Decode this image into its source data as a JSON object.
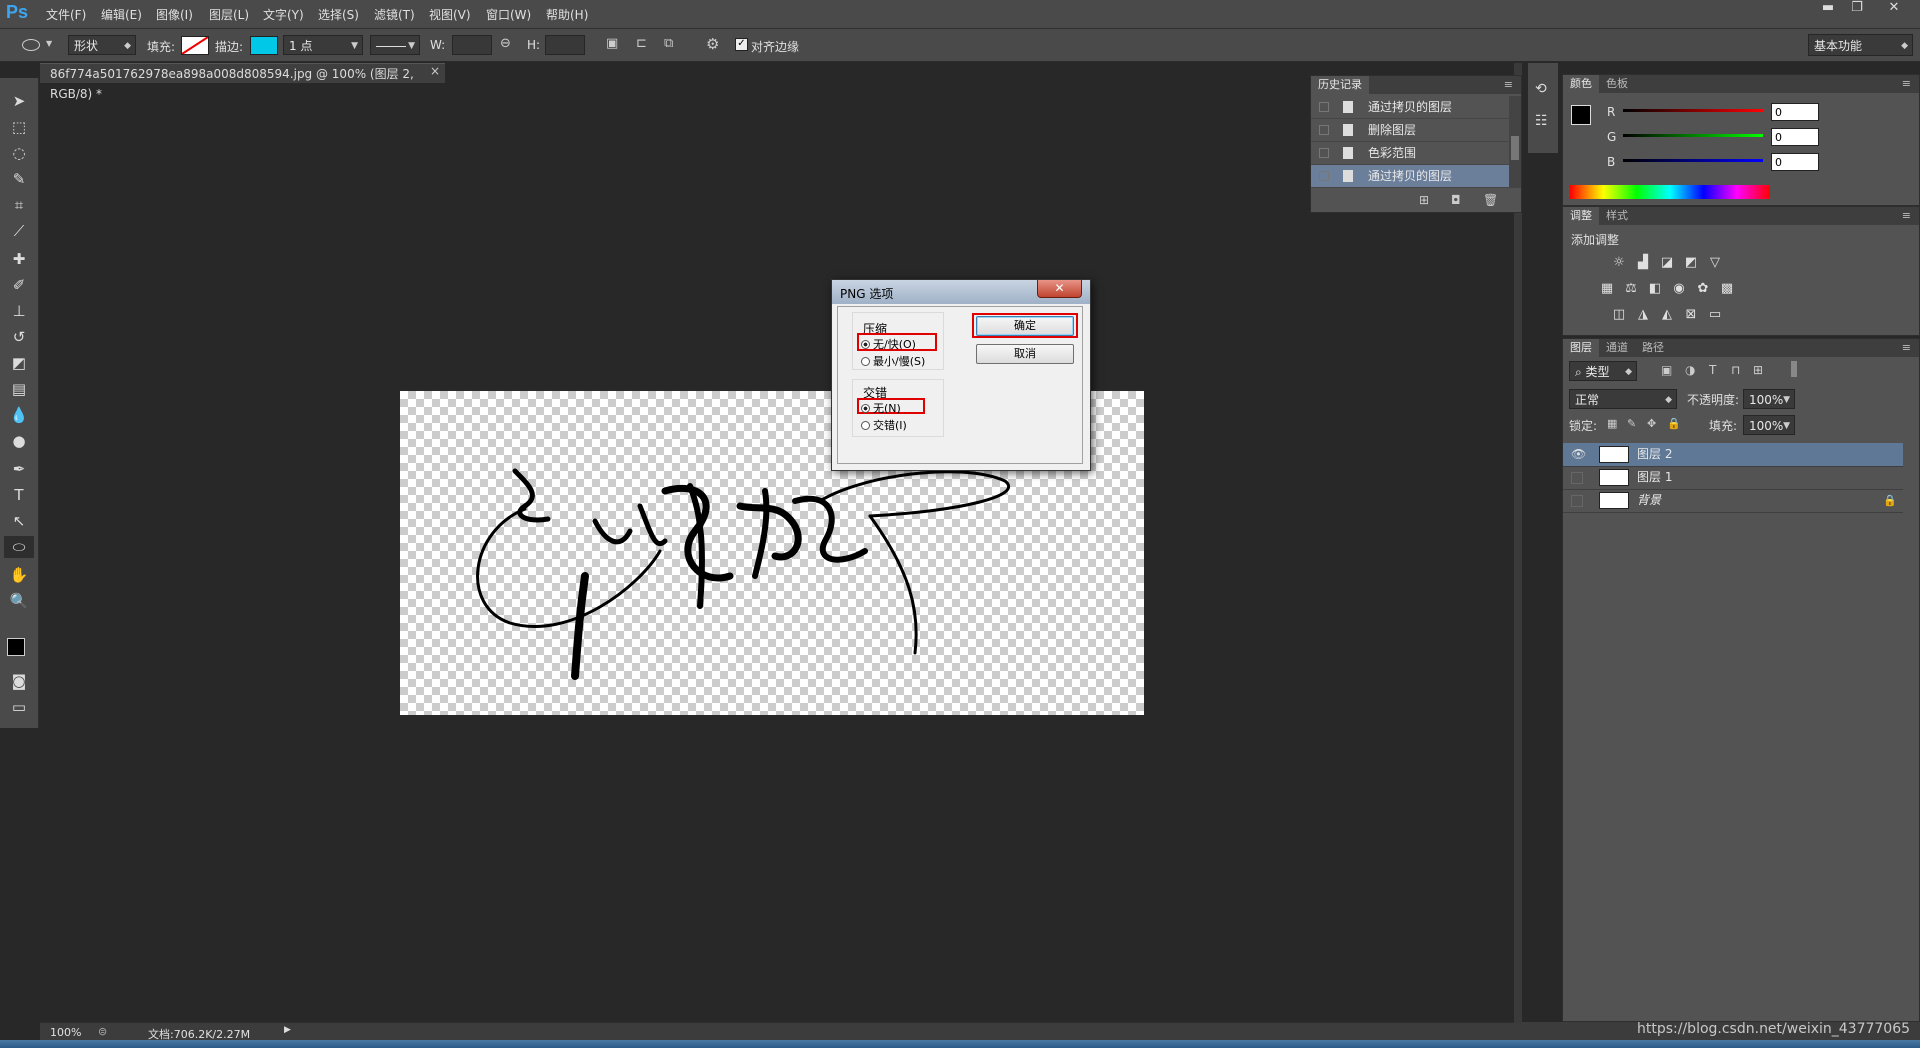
{
  "app": {
    "logo": "Ps"
  },
  "menu": [
    "文件(F)",
    "编辑(E)",
    "图像(I)",
    "图层(L)",
    "文字(Y)",
    "选择(S)",
    "滤镜(T)",
    "视图(V)",
    "窗口(W)",
    "帮助(H)"
  ],
  "window_controls": {
    "minimize": "▬",
    "restore": "❐",
    "close": "✕"
  },
  "options_bar": {
    "mode": "形状",
    "fill_label": "填充:",
    "stroke_label": "描边:",
    "stroke_size": "1 点",
    "w_label": "W:",
    "h_label": "H:",
    "align_edges": "对齐边缘",
    "workspace": "基本功能",
    "stroke_color": "#00c8e6"
  },
  "doc_tab": {
    "title": "86f774a501762978ea898a008d808594.jpg @ 100% (图层 2, RGB/8) *",
    "close": "×"
  },
  "status": {
    "zoom": "100%",
    "doc": "文档:706.2K/2.27M"
  },
  "history": {
    "title": "历史记录",
    "items": [
      "通过拷贝的图层",
      "删除图层",
      "色彩范围",
      "通过拷贝的图层"
    ],
    "selected_index": 3
  },
  "color_panel": {
    "tabs": [
      "颜色",
      "色板"
    ],
    "channels": [
      {
        "name": "R",
        "value": "0"
      },
      {
        "name": "G",
        "value": "0"
      },
      {
        "name": "B",
        "value": "0"
      }
    ]
  },
  "adjust_panel": {
    "tabs": [
      "调整",
      "样式"
    ],
    "heading": "添加调整"
  },
  "layers_panel": {
    "tabs": [
      "图层",
      "通道",
      "路径"
    ],
    "filter": "类型",
    "blend": "正常",
    "opacity_label": "不透明度:",
    "opacity": "100%",
    "lock_label": "锁定:",
    "fill_label": "填充:",
    "fill": "100%",
    "layers": [
      {
        "name": "图层 2",
        "visible": true,
        "selected": true
      },
      {
        "name": "图层 1",
        "visible": false,
        "selected": false
      },
      {
        "name": "背景",
        "visible": false,
        "selected": false
      }
    ]
  },
  "dialog": {
    "title": "PNG 选项",
    "close": "✕",
    "compression_label": "压缩",
    "compression_options": [
      "无/快(O)",
      "最小/慢(S)"
    ],
    "interlace_label": "交错",
    "interlace_options": [
      "无(N)",
      "交错(I)"
    ],
    "ok": "确定",
    "cancel": "取消"
  },
  "watermark": "https://blog.csdn.net/weixin_43777065"
}
